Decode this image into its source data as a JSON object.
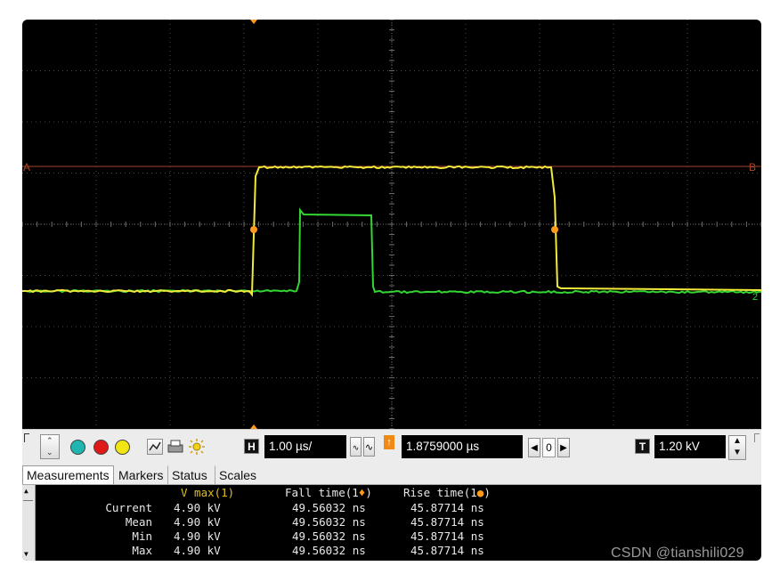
{
  "screen": {
    "marker_a": "A",
    "marker_b": "B",
    "ch2_label": "2",
    "trace_colors": {
      "ch1": "#f2ea3a",
      "ch2": "#33d633",
      "marker_line": "#a8442a",
      "marker_point": "#ff9a1a"
    }
  },
  "toolbar": {
    "timebase_badge": "H",
    "timebase_value": "1.00 µs/",
    "position_value": "1.8759000 µs",
    "delay_counter": "0",
    "trigger_badge": "T",
    "trigger_level": "1.20 kV"
  },
  "tabs": [
    "Measurements",
    "Markers",
    "Status",
    "Scales"
  ],
  "measurements": {
    "headers": {
      "col1": "V max(1)",
      "col2": "Fall time(1",
      "col2_sym": "♦",
      "col3": "Rise time(1",
      "col3_sym": "●",
      "close": ")"
    },
    "rows": [
      {
        "label": "Current",
        "vmax": "4.90 kV",
        "fall": "49.56032 ns",
        "rise": "45.87714 ns"
      },
      {
        "label": "Mean",
        "vmax": "4.90 kV",
        "fall": "49.56032 ns",
        "rise": "45.87714 ns"
      },
      {
        "label": "Min",
        "vmax": "4.90 kV",
        "fall": "49.56032 ns",
        "rise": "45.87714 ns"
      },
      {
        "label": "Max",
        "vmax": "4.90 kV",
        "fall": "49.56032 ns",
        "rise": "45.87714 ns"
      }
    ]
  },
  "watermark": "CSDN @tianshili029"
}
